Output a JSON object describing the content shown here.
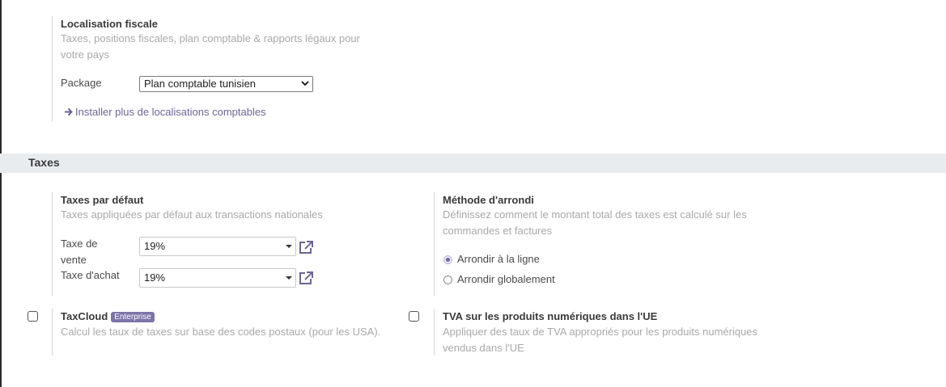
{
  "fiscal_localization": {
    "title": "Localisation fiscale",
    "description": "Taxes, positions fiscales, plan comptable & rapports légaux pour votre pays",
    "package_label": "Package",
    "package_value": "Plan comptable tunisien",
    "install_more_link": "Installer plus de localisations comptables"
  },
  "taxes_section": {
    "title": "Taxes"
  },
  "default_taxes": {
    "title": "Taxes par défaut",
    "description": "Taxes appliquées par défaut aux transactions nationales",
    "sale_tax_label": "Taxe de vente",
    "sale_tax_value": "19%",
    "purchase_tax_label": "Taxe d'achat",
    "purchase_tax_value": "19%"
  },
  "rounding_method": {
    "title": "Méthode d'arrondi",
    "description": "Définissez comment le montant total des taxes est calculé sur les commandes et factures",
    "options": [
      {
        "label": "Arrondir à la ligne",
        "selected": true
      },
      {
        "label": "Arrondir globalement",
        "selected": false
      }
    ]
  },
  "taxcloud": {
    "title": "TaxCloud",
    "badge": "Enterprise",
    "description": "Calcul les taux de taxes sur base des codes postaux (pour les USA).",
    "checked": false
  },
  "eu_digital_vat": {
    "title": "TVA sur les produits numériques dans l'UE",
    "description": "Appliquer des taux de TVA appropriés pour les produits numériques vendus dans l'UE",
    "checked": false
  },
  "colors": {
    "accent": "#6c6598",
    "section_band": "#e9ecef",
    "muted_text": "#a9a9a9"
  }
}
